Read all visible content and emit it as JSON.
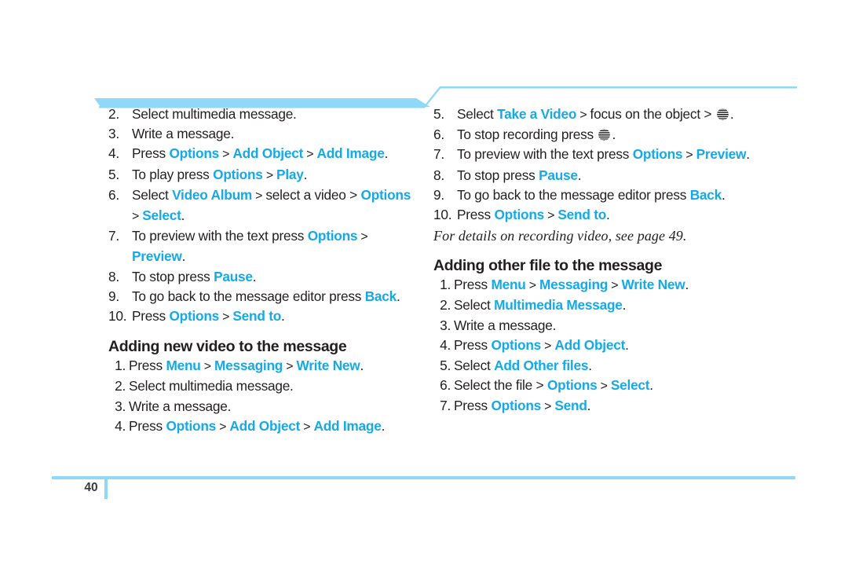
{
  "page": {
    "number": "40",
    "accent_color": "#16a9e8",
    "rule_color": "#8fd8f8",
    "text_color": "#231f20"
  },
  "left_column": {
    "continued_steps": [
      {
        "num": "2.",
        "parts": [
          {
            "t": "Select multimedia message.",
            "s": "plain"
          }
        ]
      },
      {
        "num": "3.",
        "parts": [
          {
            "t": "Write a message.",
            "s": "plain"
          }
        ]
      },
      {
        "num": "4.",
        "parts": [
          {
            "t": "Press ",
            "s": "plain"
          },
          {
            "t": "Options",
            "s": "hl"
          },
          {
            "t": " > ",
            "s": "sep"
          },
          {
            "t": "Add Object",
            "s": "hl"
          },
          {
            "t": " > ",
            "s": "sep"
          },
          {
            "t": "Add Image",
            "s": "hl"
          },
          {
            "t": ".",
            "s": "plain"
          }
        ]
      },
      {
        "num": "5.",
        "parts": [
          {
            "t": "To play press ",
            "s": "plain"
          },
          {
            "t": "Options",
            "s": "hl"
          },
          {
            "t": " > ",
            "s": "sep"
          },
          {
            "t": "Play",
            "s": "hl"
          },
          {
            "t": ".",
            "s": "plain"
          }
        ]
      },
      {
        "num": "6.",
        "parts": [
          {
            "t": "Select ",
            "s": "plain"
          },
          {
            "t": "Video Album",
            "s": "hl"
          },
          {
            "t": " > ",
            "s": "sep"
          },
          {
            "t": "select a video > ",
            "s": "plain"
          },
          {
            "t": "Options",
            "s": "hl"
          },
          {
            "t": " > ",
            "s": "sep"
          },
          {
            "t": "Select",
            "s": "hl"
          },
          {
            "t": ".",
            "s": "plain"
          }
        ]
      },
      {
        "num": "7.",
        "parts": [
          {
            "t": "To preview with the text press ",
            "s": "plain"
          },
          {
            "t": "Options",
            "s": "hl"
          },
          {
            "t": " > ",
            "s": "sep"
          },
          {
            "t": "Preview",
            "s": "hl"
          },
          {
            "t": ".",
            "s": "plain"
          }
        ]
      },
      {
        "num": "8.",
        "parts": [
          {
            "t": "To stop press ",
            "s": "plain"
          },
          {
            "t": "Pause",
            "s": "hl"
          },
          {
            "t": ".",
            "s": "plain"
          }
        ]
      },
      {
        "num": "9.",
        "parts": [
          {
            "t": "To go back to the message editor press ",
            "s": "plain"
          },
          {
            "t": "Back",
            "s": "hl"
          },
          {
            "t": ".",
            "s": "plain"
          }
        ]
      },
      {
        "num": "10.",
        "parts": [
          {
            "t": "Press ",
            "s": "plain"
          },
          {
            "t": "Options",
            "s": "hl"
          },
          {
            "t": " > ",
            "s": "sep"
          },
          {
            "t": "Send to",
            "s": "hl"
          },
          {
            "t": ".",
            "s": "plain"
          }
        ]
      }
    ],
    "heading": "Adding new video to the message",
    "steps": [
      {
        "num": "1.",
        "parts": [
          {
            "t": "Press ",
            "s": "plain"
          },
          {
            "t": "Menu",
            "s": "hl"
          },
          {
            "t": " > ",
            "s": "sep"
          },
          {
            "t": "Messaging",
            "s": "hl"
          },
          {
            "t": " > ",
            "s": "sep"
          },
          {
            "t": "Write New",
            "s": "hl"
          },
          {
            "t": ".",
            "s": "plain"
          }
        ]
      },
      {
        "num": "2.",
        "parts": [
          {
            "t": "Select multimedia message.",
            "s": "plain"
          }
        ]
      },
      {
        "num": "3.",
        "parts": [
          {
            "t": "Write a message.",
            "s": "plain"
          }
        ]
      },
      {
        "num": "4.",
        "parts": [
          {
            "t": "Press ",
            "s": "plain"
          },
          {
            "t": "Options",
            "s": "hl"
          },
          {
            "t": " > ",
            "s": "sep"
          },
          {
            "t": "Add Object",
            "s": "hl"
          },
          {
            "t": " > ",
            "s": "sep"
          },
          {
            "t": "Add Image",
            "s": "hl"
          },
          {
            "t": ".",
            "s": "plain"
          }
        ]
      }
    ]
  },
  "right_column": {
    "continued_steps": [
      {
        "num": "5.",
        "parts": [
          {
            "t": "Select ",
            "s": "plain"
          },
          {
            "t": "Take a Video",
            "s": "hl"
          },
          {
            "t": " > ",
            "s": "sep"
          },
          {
            "t": "focus on the object > ",
            "s": "plain"
          },
          {
            "t": "",
            "s": "globe"
          },
          {
            "t": ".",
            "s": "plain"
          }
        ]
      },
      {
        "num": "6.",
        "parts": [
          {
            "t": "To stop recording press ",
            "s": "plain"
          },
          {
            "t": "",
            "s": "globe"
          },
          {
            "t": ".",
            "s": "plain"
          }
        ]
      },
      {
        "num": "7.",
        "parts": [
          {
            "t": "To preview with the text press ",
            "s": "plain"
          },
          {
            "t": "Options",
            "s": "hl"
          },
          {
            "t": " > ",
            "s": "sep"
          },
          {
            "t": "Preview",
            "s": "hl"
          },
          {
            "t": ".",
            "s": "plain"
          }
        ]
      },
      {
        "num": "8.",
        "parts": [
          {
            "t": "To stop press ",
            "s": "plain"
          },
          {
            "t": "Pause",
            "s": "hl"
          },
          {
            "t": ".",
            "s": "plain"
          }
        ]
      },
      {
        "num": "9.",
        "parts": [
          {
            "t": "To go back to the message editor press ",
            "s": "plain"
          },
          {
            "t": "Back",
            "s": "hl"
          },
          {
            "t": ".",
            "s": "plain"
          }
        ]
      },
      {
        "num": "10.",
        "parts": [
          {
            "t": "Press ",
            "s": "plain"
          },
          {
            "t": "Options",
            "s": "hl"
          },
          {
            "t": " > ",
            "s": "sep"
          },
          {
            "t": "Send to",
            "s": "hl"
          },
          {
            "t": ".",
            "s": "plain"
          }
        ]
      }
    ],
    "note": "For details on recording video, see page 49.",
    "heading": "Adding other file to the message",
    "steps": [
      {
        "num": "1.",
        "parts": [
          {
            "t": "Press ",
            "s": "plain"
          },
          {
            "t": "Menu",
            "s": "hl"
          },
          {
            "t": " > ",
            "s": "sep"
          },
          {
            "t": "Messaging",
            "s": "hl"
          },
          {
            "t": " > ",
            "s": "sep"
          },
          {
            "t": "Write New",
            "s": "hl"
          },
          {
            "t": ".",
            "s": "plain"
          }
        ]
      },
      {
        "num": "2.",
        "parts": [
          {
            "t": "Select ",
            "s": "plain"
          },
          {
            "t": "Multimedia Message",
            "s": "hl"
          },
          {
            "t": ".",
            "s": "plain"
          }
        ]
      },
      {
        "num": "3.",
        "parts": [
          {
            "t": "Write a message.",
            "s": "plain"
          }
        ]
      },
      {
        "num": "4.",
        "parts": [
          {
            "t": "Press ",
            "s": "plain"
          },
          {
            "t": "Options",
            "s": "hl"
          },
          {
            "t": " > ",
            "s": "sep"
          },
          {
            "t": "Add Object",
            "s": "hl"
          },
          {
            "t": ".",
            "s": "plain"
          }
        ]
      },
      {
        "num": "5.",
        "parts": [
          {
            "t": "Select ",
            "s": "plain"
          },
          {
            "t": "Add Other files",
            "s": "hl"
          },
          {
            "t": ".",
            "s": "plain"
          }
        ]
      },
      {
        "num": "6.",
        "parts": [
          {
            "t": "Select the file > ",
            "s": "plain"
          },
          {
            "t": "Options",
            "s": "hl"
          },
          {
            "t": " > ",
            "s": "sep"
          },
          {
            "t": "Select",
            "s": "hl"
          },
          {
            "t": ".",
            "s": "plain"
          }
        ]
      },
      {
        "num": "7.",
        "parts": [
          {
            "t": "Press ",
            "s": "plain"
          },
          {
            "t": "Options",
            "s": "hl"
          },
          {
            "t": " > ",
            "s": "sep"
          },
          {
            "t": "Send",
            "s": "hl"
          },
          {
            "t": ".",
            "s": "plain"
          }
        ]
      }
    ]
  }
}
